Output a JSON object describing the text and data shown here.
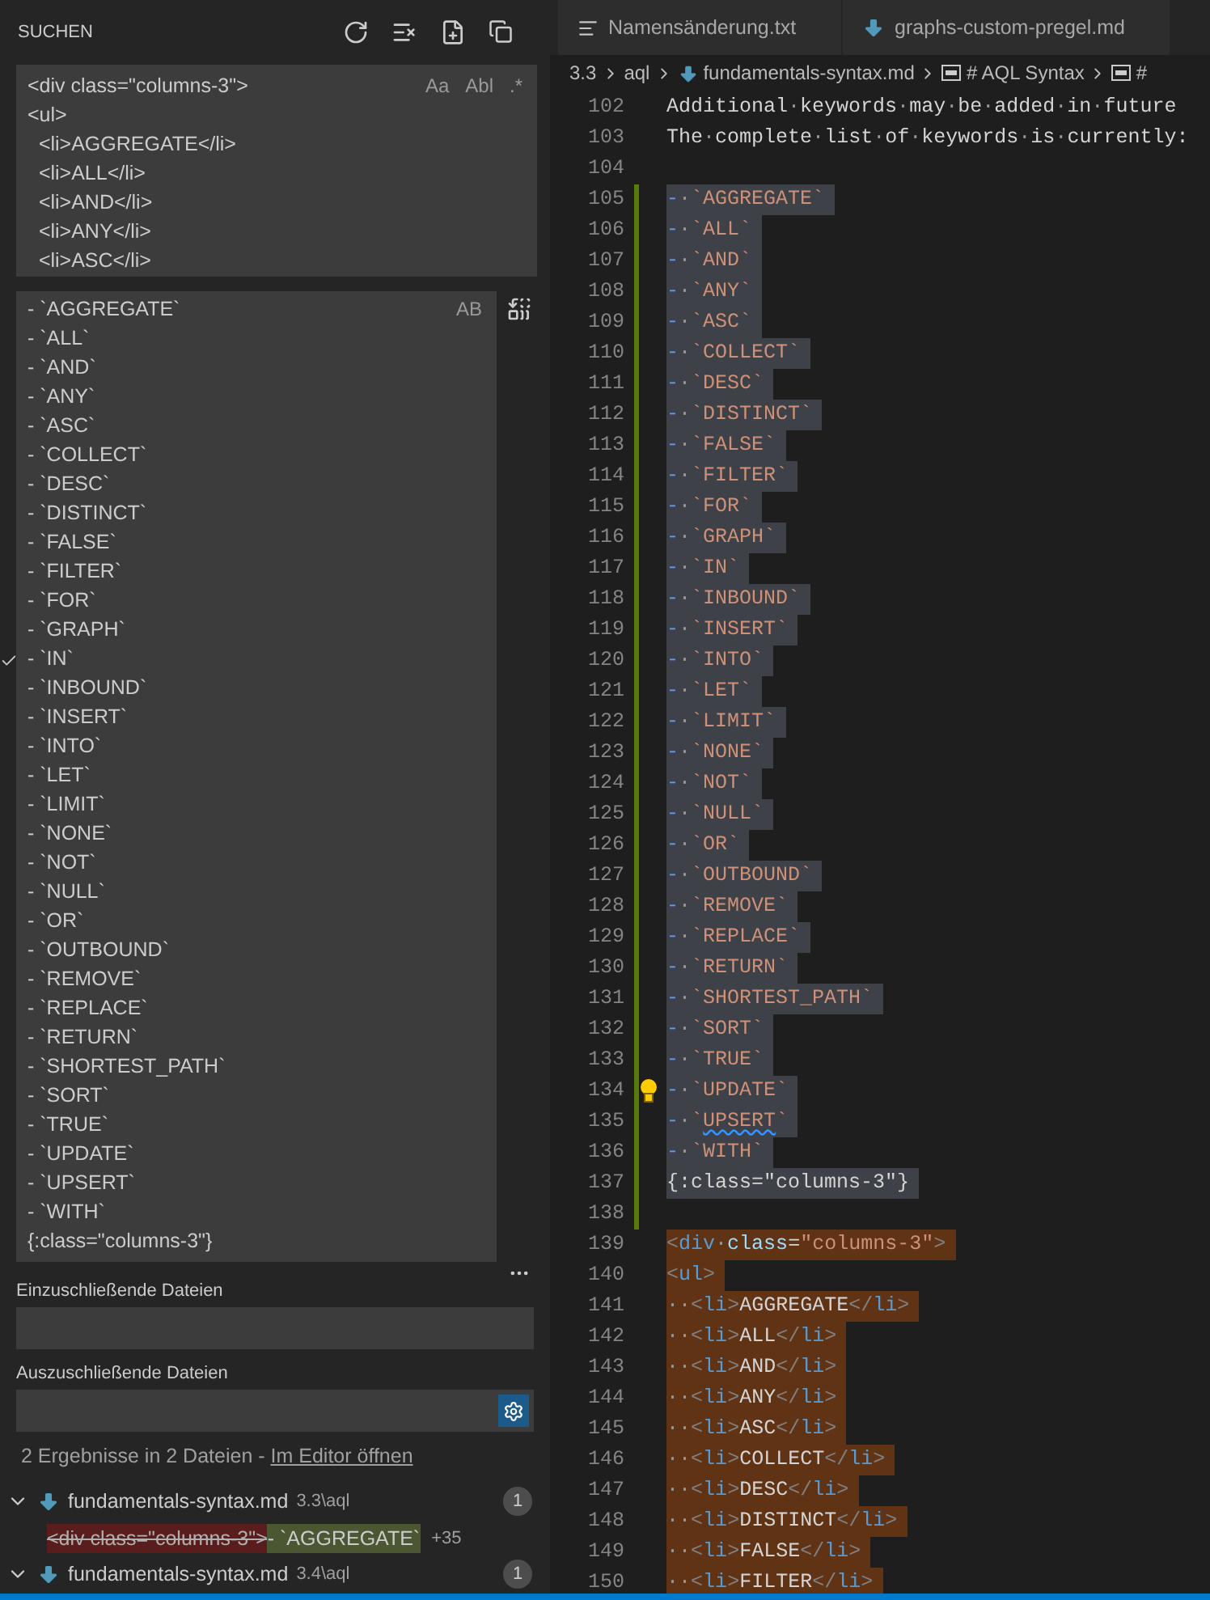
{
  "sidebar": {
    "title": "SUCHEN",
    "search": {
      "lines": [
        "<div class=\"columns-3\">",
        "<ul>",
        "  <li>AGGREGATE</li>",
        "  <li>ALL</li>",
        "  <li>AND</li>",
        "  <li>ANY</li>",
        "  <li>ASC</li>"
      ],
      "options": [
        {
          "label": "Aa",
          "selected": false
        },
        {
          "label": "Abl",
          "selected": false
        },
        {
          "label": ".*",
          "selected": false
        }
      ]
    },
    "replace": {
      "lines": [
        "- `AGGREGATE`",
        "- `ALL`",
        "- `AND`",
        "- `ANY`",
        "- `ASC`",
        "- `COLLECT`",
        "- `DESC`",
        "- `DISTINCT`",
        "- `FALSE`",
        "- `FILTER`",
        "- `FOR`",
        "- `GRAPH`",
        "- `IN`",
        "- `INBOUND`",
        "- `INSERT`",
        "- `INTO`",
        "- `LET`",
        "- `LIMIT`",
        "- `NONE`",
        "- `NOT`",
        "- `NULL`",
        "- `OR`",
        "- `OUTBOUND`",
        "- `REMOVE`",
        "- `REPLACE`",
        "- `RETURN`",
        "- `SHORTEST_PATH`",
        "- `SORT`",
        "- `TRUE`",
        "- `UPDATE`",
        "- `UPSERT`",
        "- `WITH`",
        "{:class=\"columns-3\"}"
      ],
      "options": [
        {
          "label": "AB",
          "selected": false
        }
      ]
    },
    "include": {
      "label": "Einzuschließende Dateien"
    },
    "exclude": {
      "label": "Auszuschließende Dateien"
    },
    "summary": {
      "text": "2 Ergebnisse in 2 Dateien - ",
      "link": "Im Editor öffnen"
    },
    "results": [
      {
        "file": "fundamentals-syntax.md",
        "path": "3.3\\aql",
        "count": "1",
        "expanded": true,
        "match": {
          "removed": "<div class=\"columns-3\">",
          "inserted": "- `AGGREGATE`",
          "more": "+35"
        }
      },
      {
        "file": "fundamentals-syntax.md",
        "path": "3.4\\aql",
        "count": "1",
        "expanded": true
      }
    ]
  },
  "editor": {
    "tabs": [
      {
        "label": "Namensänderung.txt",
        "kind": "text",
        "selected": false
      },
      {
        "label": "graphs-custom-pregel.md",
        "kind": "markdown",
        "selected": false
      }
    ],
    "breadcrumbs": [
      {
        "kind": "folder",
        "label": "3.3"
      },
      {
        "kind": "folder",
        "label": "aql"
      },
      {
        "kind": "file",
        "label": "fundamentals-syntax.md"
      },
      {
        "kind": "symbol",
        "label": "# AQL Syntax"
      },
      {
        "kind": "symbol",
        "label": "#"
      }
    ],
    "lines": [
      {
        "number": "102",
        "selected": false,
        "matched": false,
        "changed": false,
        "segments": [
          {
            "t": "Additional·keywords·may·be·added·in·future",
            "kind": "plain"
          }
        ]
      },
      {
        "number": "103",
        "selected": false,
        "matched": false,
        "changed": false,
        "segments": [
          {
            "t": "The·complete·list·of·keywords·is·currently:",
            "kind": "plain"
          }
        ]
      },
      {
        "number": "104",
        "changed": false
      },
      {
        "number": "105",
        "selected": true,
        "matched": false,
        "changed": true,
        "segments": [
          {
            "t": "-",
            "kind": "marker"
          },
          {
            "t": "·`AGGREGATE`",
            "kind": "string"
          }
        ]
      },
      {
        "number": "106",
        "selected": true,
        "matched": false,
        "changed": true,
        "segments": [
          {
            "t": "-",
            "kind": "marker"
          },
          {
            "t": "·`ALL`",
            "kind": "string"
          }
        ]
      },
      {
        "number": "107",
        "selected": true,
        "matched": false,
        "changed": true,
        "segments": [
          {
            "t": "-",
            "kind": "marker"
          },
          {
            "t": "·`AND`",
            "kind": "string"
          }
        ]
      },
      {
        "number": "108",
        "selected": true,
        "matched": false,
        "changed": true,
        "segments": [
          {
            "t": "-",
            "kind": "marker"
          },
          {
            "t": "·`ANY`",
            "kind": "string"
          }
        ]
      },
      {
        "number": "109",
        "selected": true,
        "matched": false,
        "changed": true,
        "segments": [
          {
            "t": "-",
            "kind": "marker"
          },
          {
            "t": "·`ASC`",
            "kind": "string"
          }
        ]
      },
      {
        "number": "110",
        "selected": true,
        "matched": false,
        "changed": true,
        "segments": [
          {
            "t": "-",
            "kind": "marker"
          },
          {
            "t": "·`COLLECT`",
            "kind": "string"
          }
        ]
      },
      {
        "number": "111",
        "selected": true,
        "matched": false,
        "changed": true,
        "segments": [
          {
            "t": "-",
            "kind": "marker"
          },
          {
            "t": "·`DESC`",
            "kind": "string"
          }
        ]
      },
      {
        "number": "112",
        "selected": true,
        "matched": false,
        "changed": true,
        "segments": [
          {
            "t": "-",
            "kind": "marker"
          },
          {
            "t": "·`DISTINCT`",
            "kind": "string"
          }
        ]
      },
      {
        "number": "113",
        "selected": true,
        "matched": false,
        "changed": true,
        "segments": [
          {
            "t": "-",
            "kind": "marker"
          },
          {
            "t": "·`FALSE`",
            "kind": "string"
          }
        ]
      },
      {
        "number": "114",
        "selected": true,
        "matched": false,
        "changed": true,
        "segments": [
          {
            "t": "-",
            "kind": "marker"
          },
          {
            "t": "·`FILTER`",
            "kind": "string"
          }
        ]
      },
      {
        "number": "115",
        "selected": true,
        "matched": false,
        "changed": true,
        "segments": [
          {
            "t": "-",
            "kind": "marker"
          },
          {
            "t": "·`FOR`",
            "kind": "string"
          }
        ]
      },
      {
        "number": "116",
        "selected": true,
        "matched": false,
        "changed": true,
        "segments": [
          {
            "t": "-",
            "kind": "marker"
          },
          {
            "t": "·`GRAPH`",
            "kind": "string"
          }
        ]
      },
      {
        "number": "117",
        "selected": true,
        "matched": false,
        "changed": true,
        "segments": [
          {
            "t": "-",
            "kind": "marker"
          },
          {
            "t": "·`IN`",
            "kind": "string"
          }
        ]
      },
      {
        "number": "118",
        "selected": true,
        "matched": false,
        "changed": true,
        "segments": [
          {
            "t": "-",
            "kind": "marker"
          },
          {
            "t": "·`INBOUND`",
            "kind": "string"
          }
        ]
      },
      {
        "number": "119",
        "selected": true,
        "matched": false,
        "changed": true,
        "segments": [
          {
            "t": "-",
            "kind": "marker"
          },
          {
            "t": "·`INSERT`",
            "kind": "string"
          }
        ]
      },
      {
        "number": "120",
        "selected": true,
        "matched": false,
        "changed": true,
        "segments": [
          {
            "t": "-",
            "kind": "marker"
          },
          {
            "t": "·`INTO`",
            "kind": "string"
          }
        ]
      },
      {
        "number": "121",
        "selected": true,
        "matched": false,
        "changed": true,
        "segments": [
          {
            "t": "-",
            "kind": "marker"
          },
          {
            "t": "·`LET`",
            "kind": "string"
          }
        ]
      },
      {
        "number": "122",
        "selected": true,
        "matched": false,
        "changed": true,
        "segments": [
          {
            "t": "-",
            "kind": "marker"
          },
          {
            "t": "·`LIMIT`",
            "kind": "string"
          }
        ]
      },
      {
        "number": "123",
        "selected": true,
        "matched": false,
        "changed": true,
        "segments": [
          {
            "t": "-",
            "kind": "marker"
          },
          {
            "t": "·`NONE`",
            "kind": "string"
          }
        ]
      },
      {
        "number": "124",
        "selected": true,
        "matched": false,
        "changed": true,
        "segments": [
          {
            "t": "-",
            "kind": "marker"
          },
          {
            "t": "·`NOT`",
            "kind": "string"
          }
        ]
      },
      {
        "number": "125",
        "selected": true,
        "matched": false,
        "changed": true,
        "segments": [
          {
            "t": "-",
            "kind": "marker"
          },
          {
            "t": "·`NULL`",
            "kind": "string"
          }
        ]
      },
      {
        "number": "126",
        "selected": true,
        "matched": false,
        "changed": true,
        "segments": [
          {
            "t": "-",
            "kind": "marker"
          },
          {
            "t": "·`OR`",
            "kind": "string"
          }
        ]
      },
      {
        "number": "127",
        "selected": true,
        "matched": false,
        "changed": true,
        "segments": [
          {
            "t": "-",
            "kind": "marker"
          },
          {
            "t": "·`OUTBOUND`",
            "kind": "string"
          }
        ]
      },
      {
        "number": "128",
        "selected": true,
        "matched": false,
        "changed": true,
        "segments": [
          {
            "t": "-",
            "kind": "marker"
          },
          {
            "t": "·`REMOVE`",
            "kind": "string"
          }
        ]
      },
      {
        "number": "129",
        "selected": true,
        "matched": false,
        "changed": true,
        "segments": [
          {
            "t": "-",
            "kind": "marker"
          },
          {
            "t": "·`REPLACE`",
            "kind": "string"
          }
        ]
      },
      {
        "number": "130",
        "selected": true,
        "matched": false,
        "changed": true,
        "segments": [
          {
            "t": "-",
            "kind": "marker"
          },
          {
            "t": "·`RETURN`",
            "kind": "string"
          }
        ]
      },
      {
        "number": "131",
        "selected": true,
        "matched": false,
        "changed": true,
        "segments": [
          {
            "t": "-",
            "kind": "marker"
          },
          {
            "t": "·`SHORTEST_PATH`",
            "kind": "string"
          }
        ]
      },
      {
        "number": "132",
        "selected": true,
        "matched": false,
        "changed": true,
        "segments": [
          {
            "t": "-",
            "kind": "marker"
          },
          {
            "t": "·`SORT`",
            "kind": "string"
          }
        ]
      },
      {
        "number": "133",
        "selected": true,
        "matched": false,
        "changed": true,
        "segments": [
          {
            "t": "-",
            "kind": "marker"
          },
          {
            "t": "·`TRUE`",
            "kind": "string"
          }
        ]
      },
      {
        "number": "134",
        "selected": true,
        "matched": false,
        "changed": true,
        "bulb": true,
        "segments": [
          {
            "t": "-",
            "kind": "marker"
          },
          {
            "t": "·`UPDATE`",
            "kind": "string"
          }
        ]
      },
      {
        "number": "135",
        "selected": true,
        "matched": false,
        "changed": true,
        "segments": [
          {
            "t": "-",
            "kind": "marker"
          },
          {
            "t": "·`",
            "kind": "string"
          },
          {
            "t": "UPSERT",
            "kind": "string",
            "squiggle": true
          },
          {
            "t": "`",
            "kind": "string"
          }
        ]
      },
      {
        "number": "136",
        "selected": true,
        "matched": false,
        "changed": true,
        "segments": [
          {
            "t": "-",
            "kind": "marker"
          },
          {
            "t": "·`WITH`",
            "kind": "string"
          }
        ]
      },
      {
        "number": "137",
        "selected": true,
        "matched": false,
        "changed": true,
        "segments": [
          {
            "t": "{:class=\"columns-3\"}",
            "kind": "plain"
          }
        ]
      },
      {
        "number": "138",
        "changed": true
      },
      {
        "number": "139",
        "selected": false,
        "matched": true,
        "changed": false,
        "segments": [
          {
            "t": "<",
            "kind": "punct"
          },
          {
            "t": "div",
            "kind": "tag"
          },
          {
            "t": "·",
            "kind": "plain"
          },
          {
            "t": "class",
            "kind": "attr"
          },
          {
            "t": "=",
            "kind": "plain"
          },
          {
            "t": "\"columns-3\"",
            "kind": "string"
          },
          {
            "t": ">",
            "kind": "punct"
          }
        ]
      },
      {
        "number": "140",
        "selected": false,
        "matched": true,
        "changed": false,
        "segments": [
          {
            "t": "<",
            "kind": "punct"
          },
          {
            "t": "ul",
            "kind": "tag"
          },
          {
            "t": ">",
            "kind": "punct"
          }
        ]
      },
      {
        "number": "141",
        "selected": false,
        "matched": true,
        "changed": false,
        "segments": [
          {
            "t": "··<",
            "kind": "punct"
          },
          {
            "t": "li",
            "kind": "tag"
          },
          {
            "t": ">",
            "kind": "punct"
          },
          {
            "t": "AGGREGATE",
            "kind": "plain"
          },
          {
            "t": "</",
            "kind": "punct"
          },
          {
            "t": "li",
            "kind": "tag"
          },
          {
            "t": ">",
            "kind": "punct"
          }
        ]
      },
      {
        "number": "142",
        "selected": false,
        "matched": true,
        "changed": false,
        "segments": [
          {
            "t": "··<",
            "kind": "punct"
          },
          {
            "t": "li",
            "kind": "tag"
          },
          {
            "t": ">",
            "kind": "punct"
          },
          {
            "t": "ALL",
            "kind": "plain"
          },
          {
            "t": "</",
            "kind": "punct"
          },
          {
            "t": "li",
            "kind": "tag"
          },
          {
            "t": ">",
            "kind": "punct"
          }
        ]
      },
      {
        "number": "143",
        "selected": false,
        "matched": true,
        "changed": false,
        "segments": [
          {
            "t": "··<",
            "kind": "punct"
          },
          {
            "t": "li",
            "kind": "tag"
          },
          {
            "t": ">",
            "kind": "punct"
          },
          {
            "t": "AND",
            "kind": "plain"
          },
          {
            "t": "</",
            "kind": "punct"
          },
          {
            "t": "li",
            "kind": "tag"
          },
          {
            "t": ">",
            "kind": "punct"
          }
        ]
      },
      {
        "number": "144",
        "selected": false,
        "matched": true,
        "changed": false,
        "segments": [
          {
            "t": "··<",
            "kind": "punct"
          },
          {
            "t": "li",
            "kind": "tag"
          },
          {
            "t": ">",
            "kind": "punct"
          },
          {
            "t": "ANY",
            "kind": "plain"
          },
          {
            "t": "</",
            "kind": "punct"
          },
          {
            "t": "li",
            "kind": "tag"
          },
          {
            "t": ">",
            "kind": "punct"
          }
        ]
      },
      {
        "number": "145",
        "selected": false,
        "matched": true,
        "changed": false,
        "segments": [
          {
            "t": "··<",
            "kind": "punct"
          },
          {
            "t": "li",
            "kind": "tag"
          },
          {
            "t": ">",
            "kind": "punct"
          },
          {
            "t": "ASC",
            "kind": "plain"
          },
          {
            "t": "</",
            "kind": "punct"
          },
          {
            "t": "li",
            "kind": "tag"
          },
          {
            "t": ">",
            "kind": "punct"
          }
        ]
      },
      {
        "number": "146",
        "selected": false,
        "matched": true,
        "changed": false,
        "segments": [
          {
            "t": "··<",
            "kind": "punct"
          },
          {
            "t": "li",
            "kind": "tag"
          },
          {
            "t": ">",
            "kind": "punct"
          },
          {
            "t": "COLLECT",
            "kind": "plain"
          },
          {
            "t": "</",
            "kind": "punct"
          },
          {
            "t": "li",
            "kind": "tag"
          },
          {
            "t": ">",
            "kind": "punct"
          }
        ]
      },
      {
        "number": "147",
        "selected": false,
        "matched": true,
        "changed": false,
        "segments": [
          {
            "t": "··<",
            "kind": "punct"
          },
          {
            "t": "li",
            "kind": "tag"
          },
          {
            "t": ">",
            "kind": "punct"
          },
          {
            "t": "DESC",
            "kind": "plain"
          },
          {
            "t": "</",
            "kind": "punct"
          },
          {
            "t": "li",
            "kind": "tag"
          },
          {
            "t": ">",
            "kind": "punct"
          }
        ]
      },
      {
        "number": "148",
        "selected": false,
        "matched": true,
        "changed": false,
        "segments": [
          {
            "t": "··<",
            "kind": "punct"
          },
          {
            "t": "li",
            "kind": "tag"
          },
          {
            "t": ">",
            "kind": "punct"
          },
          {
            "t": "DISTINCT",
            "kind": "plain"
          },
          {
            "t": "</",
            "kind": "punct"
          },
          {
            "t": "li",
            "kind": "tag"
          },
          {
            "t": ">",
            "kind": "punct"
          }
        ]
      },
      {
        "number": "149",
        "selected": false,
        "matched": true,
        "changed": false,
        "segments": [
          {
            "t": "··<",
            "kind": "punct"
          },
          {
            "t": "li",
            "kind": "tag"
          },
          {
            "t": ">",
            "kind": "punct"
          },
          {
            "t": "FALSE",
            "kind": "plain"
          },
          {
            "t": "</",
            "kind": "punct"
          },
          {
            "t": "li",
            "kind": "tag"
          },
          {
            "t": ">",
            "kind": "punct"
          }
        ]
      },
      {
        "number": "150",
        "selected": false,
        "matched": true,
        "changed": false,
        "segments": [
          {
            "t": "··<",
            "kind": "punct"
          },
          {
            "t": "li",
            "kind": "tag"
          },
          {
            "t": ">",
            "kind": "punct"
          },
          {
            "t": "FILTER",
            "kind": "plain"
          },
          {
            "t": "</",
            "kind": "punct"
          },
          {
            "t": "li",
            "kind": "tag"
          },
          {
            "t": ">",
            "kind": "punct"
          }
        ]
      }
    ]
  }
}
